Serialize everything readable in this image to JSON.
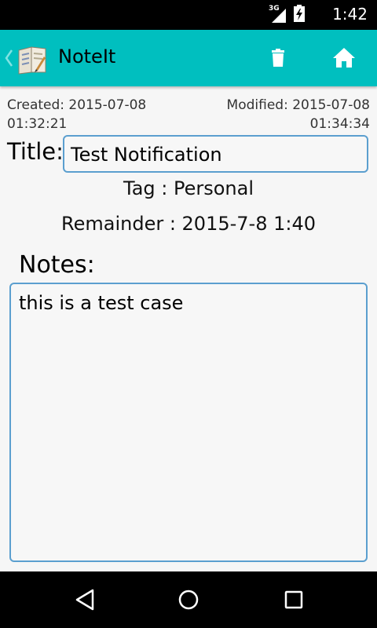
{
  "status_bar": {
    "network_label": "3G",
    "time": "1:42",
    "icons": [
      "signal-icon",
      "battery-icon"
    ]
  },
  "app_bar": {
    "title": "NoteIt",
    "background_color": "#00bfbf",
    "actions": [
      "delete-icon",
      "home-icon"
    ]
  },
  "note": {
    "created_label": "Created: 2015-07-08",
    "created_time": "01:32:21",
    "modified_label": "Modified: 2015-07-08",
    "modified_time": "01:34:34",
    "title_label": "Title:",
    "title_value": "Test Notification",
    "tag_line": "Tag : Personal",
    "reminder_line": "Remainder : 2015-7-8 1:40",
    "notes_label": "Notes:",
    "notes_value": "this is a test case"
  },
  "nav_bar": {
    "buttons": [
      "back-icon",
      "home-circle-icon",
      "recent-apps-icon"
    ]
  },
  "colors": {
    "accent": "#00bfbf",
    "field_border": "#5b9fcf"
  }
}
